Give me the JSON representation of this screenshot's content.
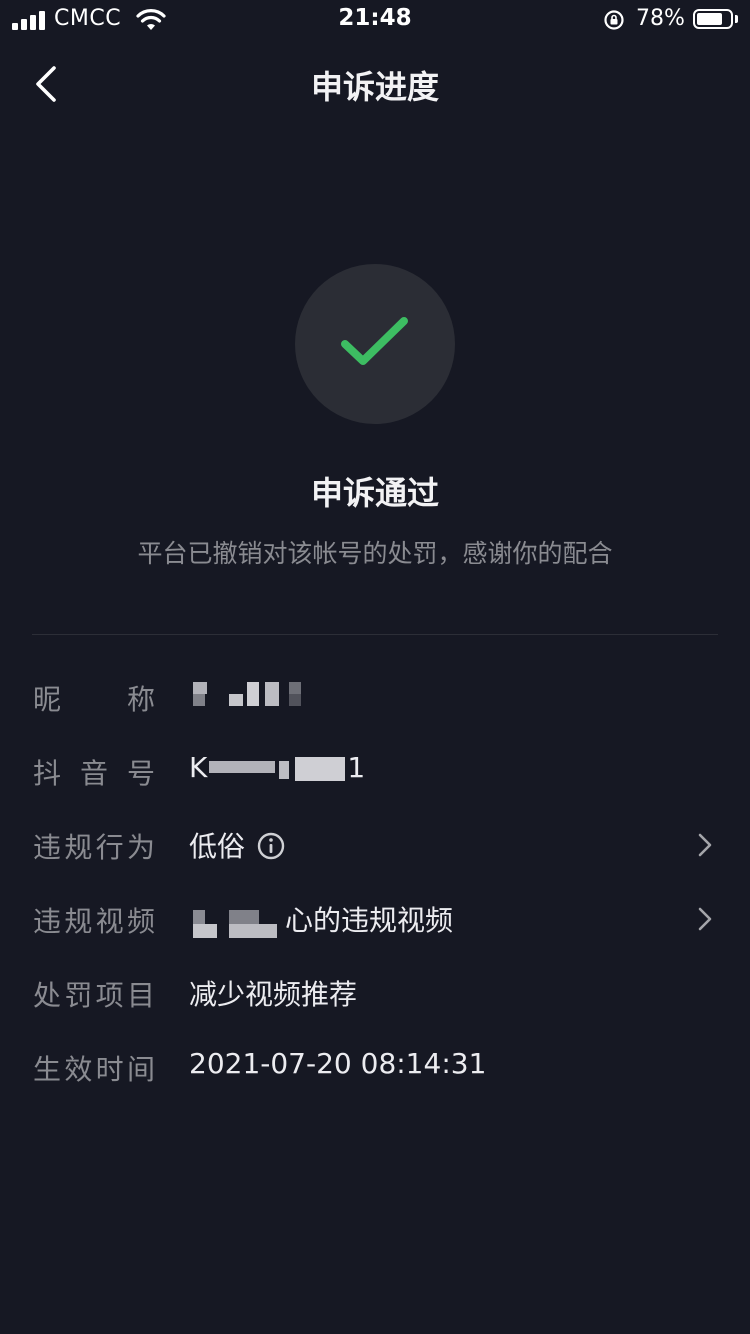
{
  "status_bar": {
    "carrier": "CMCC",
    "time": "21:48",
    "battery_percent": "78%",
    "battery_level": 0.78
  },
  "nav": {
    "title": "申诉进度",
    "back_icon": "chevron-left-icon"
  },
  "result": {
    "icon": "checkmark-icon",
    "icon_color": "#3dbd62",
    "title": "申诉通过",
    "description": "平台已撤销对该帐号的处罚，感谢你的配合"
  },
  "details": {
    "nickname": {
      "label": "昵称",
      "value": ""
    },
    "douyin_id": {
      "label": "抖音号",
      "value_prefix": "K",
      "value_suffix": "1"
    },
    "violation_type": {
      "label": "违规行为",
      "value": "低俗"
    },
    "violation_video": {
      "label": "违规视频",
      "value_suffix": "心的违规视频"
    },
    "penalty": {
      "label": "处罚项目",
      "value": "减少视频推荐"
    },
    "effective_time": {
      "label": "生效时间",
      "value": "2021-07-20 08:14:31"
    }
  }
}
